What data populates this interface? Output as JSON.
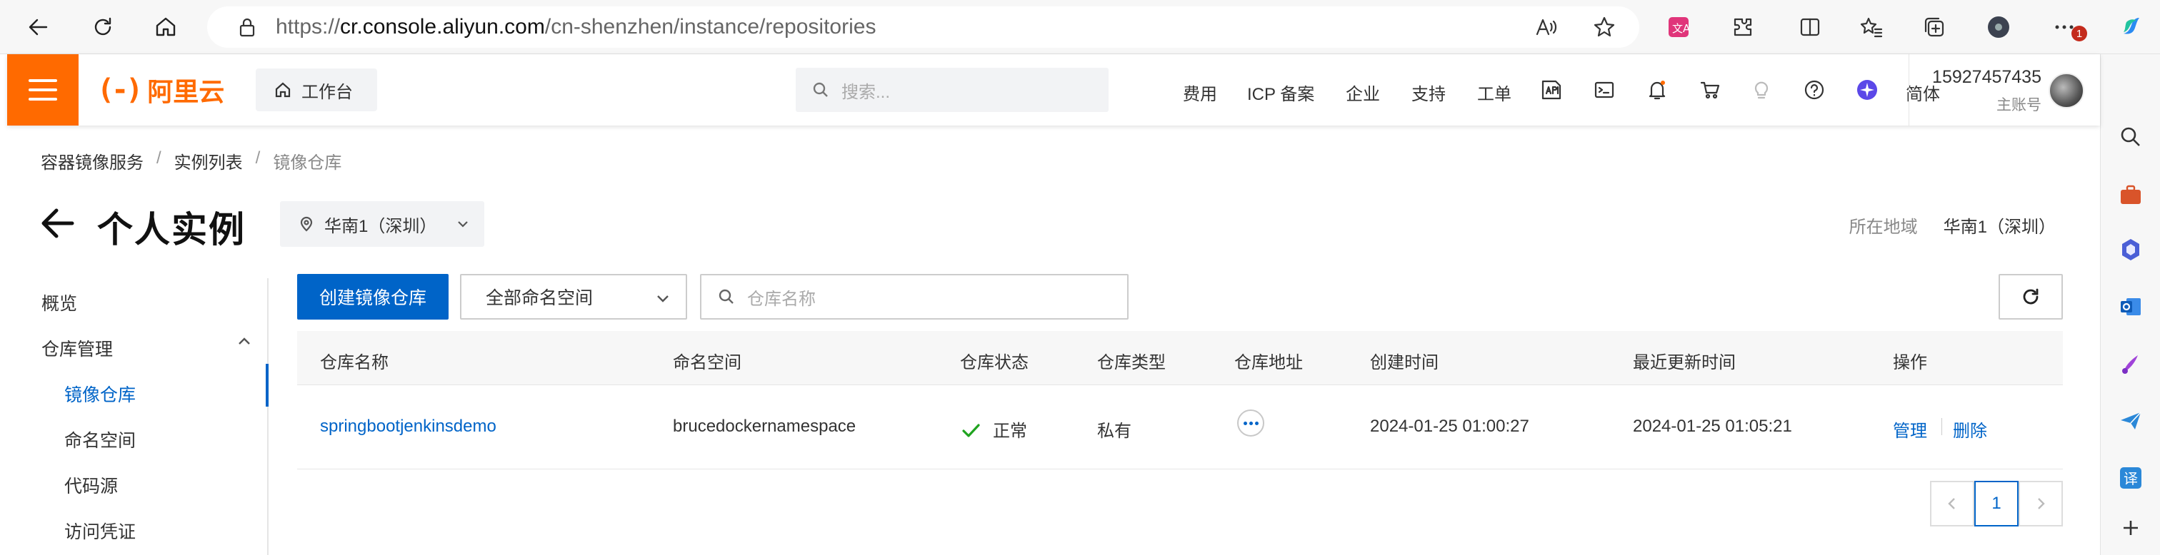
{
  "browser": {
    "url_scheme": "https://",
    "url_host": "cr.console.aliyun.com",
    "url_path": "/cn-shenzhen/instance/repositories",
    "notification_count": "1"
  },
  "topbar": {
    "logo_mark": "(-)",
    "logo_text": "阿里云",
    "workbench_label": "工作台",
    "search_placeholder": "搜索...",
    "links": [
      "费用",
      "ICP 备案",
      "企业",
      "支持",
      "工单"
    ],
    "language": "简体",
    "account_phone": "15927457435",
    "account_role": "主账号",
    "brand_color": "#ff6a00"
  },
  "breadcrumb": [
    "容器镜像服务",
    "实例列表",
    "镜像仓库"
  ],
  "header": {
    "title": "个人实例",
    "region_selected": "华南1（深圳）",
    "region_label": "所在地域",
    "region_value": "华南1（深圳）"
  },
  "leftnav": {
    "overview": "概览",
    "group_repo": "仓库管理",
    "items": [
      "镜像仓库",
      "命名空间",
      "代码源",
      "访问凭证"
    ],
    "active_index": 0
  },
  "toolbar": {
    "create_label": "创建镜像仓库",
    "namespace_filter": "全部命名空间",
    "search_placeholder": "仓库名称"
  },
  "table": {
    "columns": [
      "仓库名称",
      "命名空间",
      "仓库状态",
      "仓库类型",
      "仓库地址",
      "创建时间",
      "最近更新时间",
      "操作"
    ],
    "rows": [
      {
        "name": "springbootjenkinsdemo",
        "namespace": "brucedockernamespace",
        "status": "正常",
        "type": "私有",
        "created": "2024-01-25 01:00:27",
        "updated": "2024-01-25 01:05:21",
        "actions": [
          "管理",
          "删除"
        ]
      }
    ]
  },
  "pagination": {
    "current_page": "1"
  },
  "colors": {
    "primary": "#0064c8",
    "success": "#1fa31f"
  }
}
